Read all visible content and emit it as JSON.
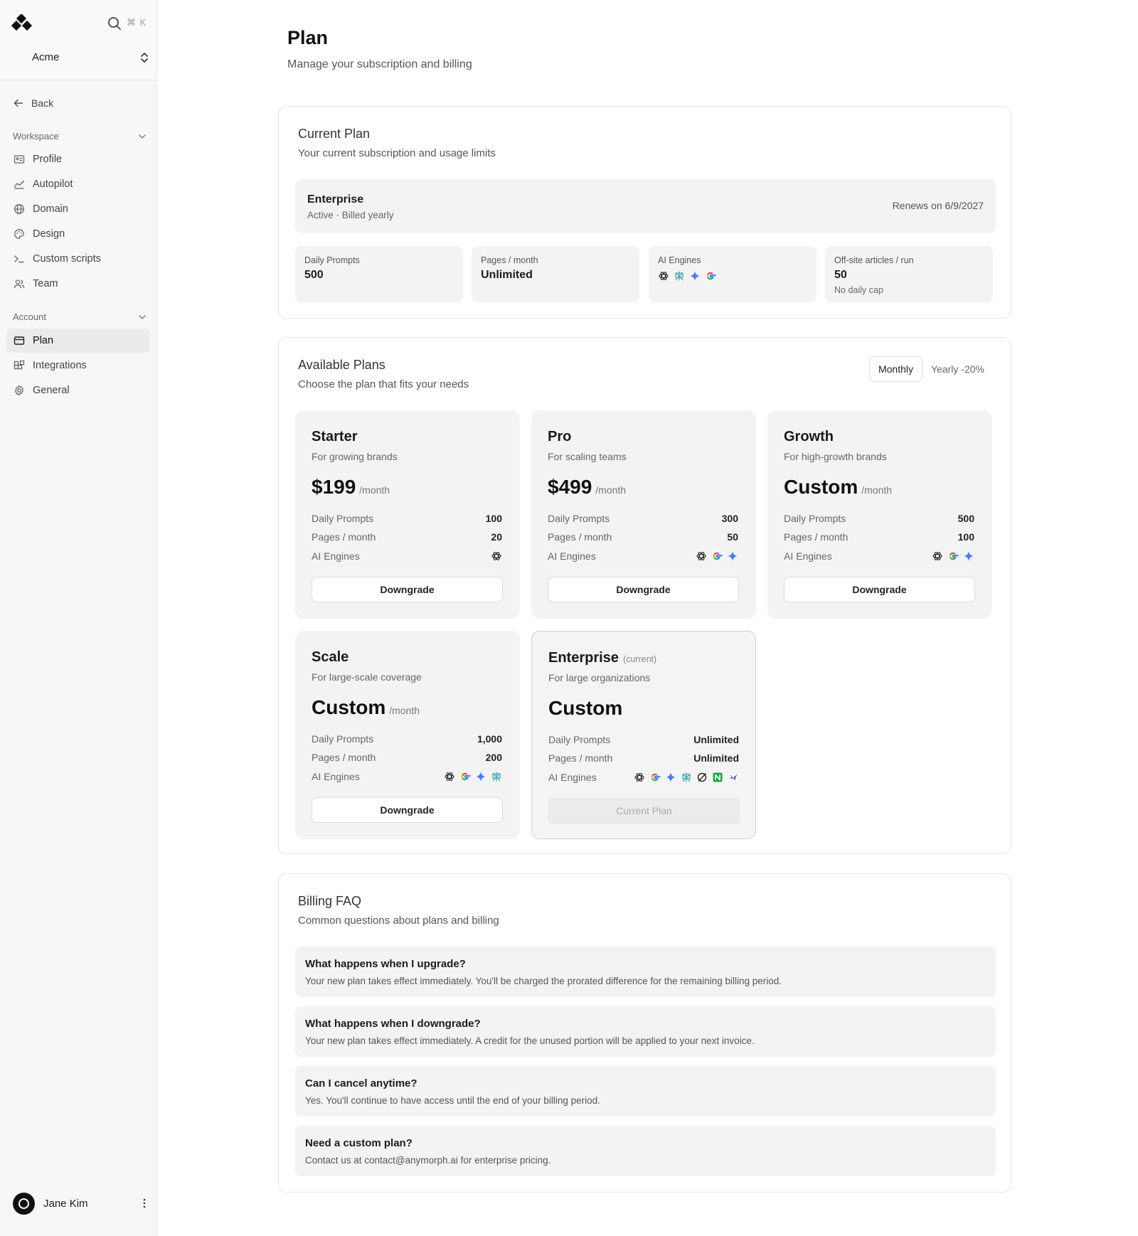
{
  "sidebar": {
    "workspace_name": "Acme",
    "shortcut": "⌘ K",
    "back_label": "Back",
    "sections": [
      {
        "label": "Workspace",
        "items": [
          "Profile",
          "Autopilot",
          "Domain",
          "Design",
          "Custom scripts",
          "Team"
        ]
      },
      {
        "label": "Account",
        "items": [
          "Plan",
          "Integrations",
          "General"
        ]
      }
    ],
    "active_item": "Plan",
    "user_name": "Jane Kim"
  },
  "page": {
    "title": "Plan",
    "subtitle": "Manage your subscription and billing"
  },
  "current_plan": {
    "title": "Current Plan",
    "subtitle": "Your current subscription and usage limits",
    "plan_name": "Enterprise",
    "status": "Active · Billed yearly",
    "renews": "Renews on 6/9/2027",
    "stats": [
      {
        "label": "Daily Prompts",
        "value": "500",
        "note": ""
      },
      {
        "label": "Pages / month",
        "value": "Unlimited",
        "note": ""
      },
      {
        "label": "AI Engines",
        "icons": [
          "openai-icon",
          "perplexity-icon",
          "gemini-icon",
          "google-icon"
        ]
      },
      {
        "label": "Off-site articles / run",
        "value": "50",
        "note": "No daily cap"
      }
    ]
  },
  "available_plans": {
    "title": "Available Plans",
    "subtitle": "Choose the plan that fits your needs",
    "billing_toggle": {
      "monthly": "Monthly",
      "yearly": "Yearly -20%",
      "selected": "Monthly"
    },
    "row_labels": {
      "prompts": "Daily Prompts",
      "pages": "Pages / month",
      "engines": "AI Engines"
    },
    "plans": [
      {
        "name": "Starter",
        "tag": "",
        "desc": "For growing brands",
        "price": "$199",
        "period": "/month",
        "prompts": "100",
        "pages": "20",
        "engines": [
          "openai-icon"
        ],
        "button": "Downgrade"
      },
      {
        "name": "Pro",
        "tag": "",
        "desc": "For scaling teams",
        "price": "$499",
        "period": "/month",
        "prompts": "300",
        "pages": "50",
        "engines": [
          "openai-icon",
          "google-icon",
          "gemini-icon"
        ],
        "button": "Downgrade"
      },
      {
        "name": "Growth",
        "tag": "",
        "desc": "For high-growth brands",
        "price": "Custom",
        "period": "/month",
        "prompts": "500",
        "pages": "100",
        "engines": [
          "openai-icon",
          "google-icon",
          "gemini-icon"
        ],
        "button": "Downgrade"
      },
      {
        "name": "Scale",
        "tag": "",
        "desc": "For large-scale coverage",
        "price": "Custom",
        "period": "/month",
        "prompts": "1,000",
        "pages": "200",
        "engines": [
          "openai-icon",
          "google-icon",
          "gemini-icon",
          "perplexity-icon"
        ],
        "button": "Downgrade"
      },
      {
        "name": "Enterprise",
        "tag": "(current)",
        "desc": "For large organizations",
        "price": "Custom",
        "period": "",
        "prompts": "Unlimited",
        "pages": "Unlimited",
        "engines": [
          "openai-icon",
          "google-icon",
          "gemini-icon",
          "perplexity-icon",
          "grok-icon",
          "copilot-n-icon",
          "claude-icon"
        ],
        "button": "Current Plan"
      }
    ]
  },
  "faq": {
    "title": "Billing FAQ",
    "subtitle": "Common questions about plans and billing",
    "items": [
      {
        "q": "What happens when I upgrade?",
        "a": "Your new plan takes effect immediately. You'll be charged the prorated difference for the remaining billing period."
      },
      {
        "q": "What happens when I downgrade?",
        "a": "Your new plan takes effect immediately. A credit for the unused portion will be applied to your next invoice."
      },
      {
        "q": "Can I cancel anytime?",
        "a": "Yes. You'll continue to have access until the end of your billing period."
      },
      {
        "q": "Need a custom plan?",
        "a": "Contact us at contact@anymorph.ai for enterprise pricing."
      }
    ]
  },
  "colors": {
    "accent": "#111111",
    "muted": "#f3f3f3",
    "gemini": "#4f7cf6",
    "google_blue": "#4285F4"
  }
}
